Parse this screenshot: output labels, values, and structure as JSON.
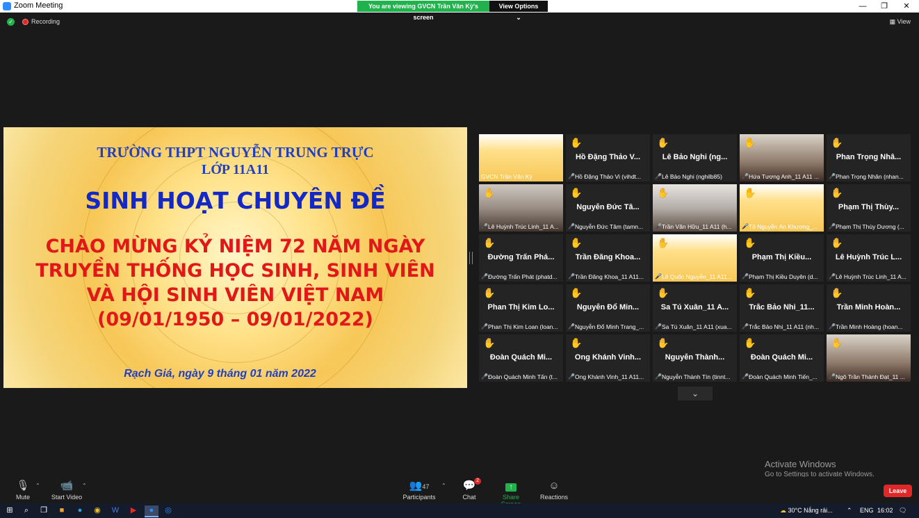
{
  "window": {
    "title": "Zoom Meeting",
    "minimize": "—",
    "maximize": "❐",
    "close": "✕"
  },
  "banner": {
    "viewing": "You are viewing GVCN Trần Văn Kỳ's screen",
    "view_options": "View Options ⌄"
  },
  "status": {
    "recording": "Recording",
    "view": "View"
  },
  "slide": {
    "school": "TRƯỜNG THPT NGUYỄN TRUNG TRỰC",
    "class": "LỚP 11A11",
    "topic": "SINH HOẠT CHUYÊN ĐỀ",
    "title_line1": "CHÀO MỪNG KỶ NIỆM 72 NĂM NGÀY",
    "title_line2": "TRUYỀN THỐNG HỌC SINH, SINH VIÊN",
    "title_line3": "VÀ HỘI SINH VIÊN VIỆT NAM",
    "title_line4": "(09/01/1950 – 09/01/2022)",
    "date": "Rạch Giá, ngày 9 tháng 01 năm 2022"
  },
  "participants": [
    {
      "big": "",
      "small": "GVCN Trần Văn Kỳ",
      "video": true,
      "hand": false
    },
    {
      "big": "Hồ Đặng Thảo V...",
      "small": "Hồ Đặng Thảo Vi (vihdt...",
      "video": false,
      "hand": true
    },
    {
      "big": "Lê Bảo Nghi (ng...",
      "small": "Lê Bảo Nghi (nghilb85)",
      "video": false,
      "hand": true
    },
    {
      "big": "",
      "small": "Hứa Tượng Anh_11 A11 ...",
      "video": true,
      "hand": true
    },
    {
      "big": "Phan Trọng Nhâ...",
      "small": "Phan Trọng Nhân (nhan...",
      "video": false,
      "hand": true
    },
    {
      "big": "",
      "small": "Lê Huỳnh Trúc Linh_11 A...",
      "video": true,
      "hand": true
    },
    {
      "big": "Nguyễn Đức Tâ...",
      "small": "Nguyễn Đức Tâm (tamn...",
      "video": false,
      "hand": true
    },
    {
      "big": "",
      "small": "Trần Văn Hữu_11 A11 (h...",
      "video": true,
      "hand": true
    },
    {
      "big": "",
      "small": "Tô Nguyễn An Khương_...",
      "video": true,
      "hand": true
    },
    {
      "big": "Phạm Thị Thùy...",
      "small": "Phạm Thị Thùy Dương (...",
      "video": false,
      "hand": true
    },
    {
      "big": "Đường Trấn Phá...",
      "small": "Đường Trấn Phát (phatd...",
      "video": false,
      "hand": true
    },
    {
      "big": "Trần Đăng Khoa...",
      "small": "Trần Đăng Khoa_11 A11...",
      "video": false,
      "hand": true
    },
    {
      "big": "",
      "small": "Lê Quốc Nguyễn_11 A11...",
      "video": true,
      "hand": true
    },
    {
      "big": "Phạm Thị Kiều...",
      "small": "Phạm Thị Kiều Duyên (d...",
      "video": false,
      "hand": true
    },
    {
      "big": "Lê Huỳnh Trúc L...",
      "small": "Lê Huỳnh Trúc Linh_11 A...",
      "video": false,
      "hand": true
    },
    {
      "big": "Phan Thị Kim Lo...",
      "small": "Phan Thị Kim Loan (loan...",
      "video": false,
      "hand": true
    },
    {
      "big": "Nguyễn Đổ Min...",
      "small": "Nguyễn Đổ Minh Trang_...",
      "video": false,
      "hand": true
    },
    {
      "big": "Sa Tú Xuân_11 A...",
      "small": "Sa Tú Xuân_11 A11 (xua...",
      "video": false,
      "hand": true
    },
    {
      "big": "Trắc Bảo Nhi_11...",
      "small": "Trắc Bảo Nhi_11 A11 (nh...",
      "video": false,
      "hand": true
    },
    {
      "big": "Trần Minh Hoàn...",
      "small": "Trần Minh Hoàng (hoan...",
      "video": false,
      "hand": true
    },
    {
      "big": "Đoàn Quách Mi...",
      "small": "Đoàn Quách Minh Tấn (t...",
      "video": false,
      "hand": true
    },
    {
      "big": "Ong Khánh Vinh...",
      "small": "Ong Khánh Vinh_11 A11...",
      "video": false,
      "hand": true
    },
    {
      "big": "Nguyễn Thành...",
      "small": "Nguyễn Thành Tín (tinnt...",
      "video": false,
      "hand": true
    },
    {
      "big": "Đoàn Quách Mi...",
      "small": "Đoàn Quách Minh Tiến_...",
      "video": false,
      "hand": true
    },
    {
      "big": "",
      "small": "Ngô Trần Thành Đạt_11 ...",
      "video": true,
      "hand": true
    }
  ],
  "watermark": {
    "line1": "Activate Windows",
    "line2": "Go to Settings to activate Windows."
  },
  "toolbar": {
    "mute": "Mute",
    "start_video": "Start Video",
    "participants": "Participants",
    "participants_count": "47",
    "chat": "Chat",
    "chat_badge": "2",
    "share_screen": "Share Screen",
    "reactions": "Reactions",
    "leave": "Leave"
  },
  "taskbar": {
    "weather": "30°C  Nắng rải...",
    "lang": "ENG",
    "time": "16:02"
  }
}
